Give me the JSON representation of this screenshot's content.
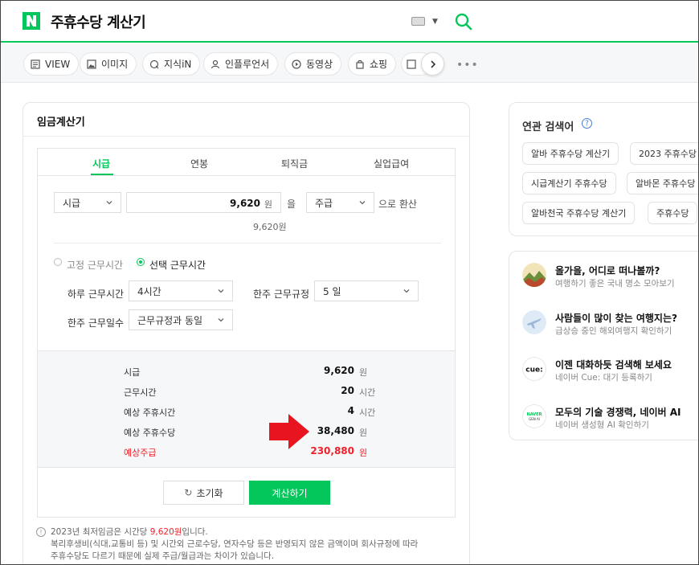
{
  "header": {
    "logo": "N",
    "query": "주휴수당 계산기",
    "icons": [
      "naver-logo-icon",
      "keyboard-icon",
      "search-icon"
    ]
  },
  "tabs": [
    {
      "label": "VIEW",
      "icon": "view-icon"
    },
    {
      "label": "이미지",
      "icon": "image-icon"
    },
    {
      "label": "지식iN",
      "icon": "q-icon"
    },
    {
      "label": "인플루언서",
      "icon": "person-icon"
    },
    {
      "label": "동영상",
      "icon": "play-icon"
    },
    {
      "label": "쇼핑",
      "icon": "bag-icon"
    }
  ],
  "calculator": {
    "title": "임금계산기",
    "tabs": [
      "시급",
      "연봉",
      "퇴직금",
      "실업급여"
    ],
    "active_tab": "시급",
    "wage_type": "시급",
    "amount": "9,620",
    "amount_unit": "원",
    "particle": "을",
    "convert_to": "주급",
    "convert_suffix": "으로 환산",
    "amount_readout": "9,620원",
    "mode_fixed": "고정 근무시간",
    "mode_select": "선택 근무시간",
    "daily_hours_label": "하루 근무시간",
    "daily_hours": "4시간",
    "weekly_rule_label": "한주 근무규정",
    "weekly_rule": "5 일",
    "weekly_days_label": "한주 근무일수",
    "weekly_days": "근무규정과 동일",
    "results": [
      {
        "label": "시급",
        "value": "9,620",
        "unit": "원",
        "highlight": false
      },
      {
        "label": "근무시간",
        "value": "20",
        "unit": "시간",
        "highlight": false
      },
      {
        "label": "예상 주휴시간",
        "value": "4",
        "unit": "시간",
        "highlight": false
      },
      {
        "label": "예상 주휴수당",
        "value": "38,480",
        "unit": "원",
        "highlight": false
      },
      {
        "label": "예상주급",
        "value": "230,880",
        "unit": "원",
        "highlight": true
      }
    ],
    "reset_label": "초기화",
    "calc_label": "계산하기",
    "notice_prefix": "2023년 최저임금은 시간당 ",
    "notice_wage": "9,620원",
    "notice_suffix": "입니다.",
    "notice_line2": "복리후생비(식대,교통비 등) 및 시간외 근로수당, 연자수당 등은 반영되지 않은 금액이며 회사규정에 따라",
    "notice_line3": "주휴수당도 다르기 때문에 실제 주급/월급과는 차이가 있습니다."
  },
  "related": {
    "title": "연관 검색어",
    "keywords": [
      "알바 주휴수당 계산기",
      "2023 주휴수당",
      "시급계산기 주휴수당",
      "알바몬 주휴수당",
      "알바천국 주휴수당 계산기",
      "주휴수당"
    ]
  },
  "promos": [
    {
      "title": "올가을, 어디로 떠나볼까?",
      "sub": "여행하기 좋은 국내 명소 모아보기",
      "icon": "landscape-icon"
    },
    {
      "title": "사람들이 많이 찾는 여행지는?",
      "sub": "급상승 중인 해외여행지 확인하기",
      "icon": "airplane-icon"
    },
    {
      "title": "이젠 대화하듯 검색해 보세요",
      "sub": "네이버 Cue: 대기 등록하기",
      "icon": "cue-logo-icon",
      "logo_text": "cue:"
    },
    {
      "title": "모두의 기술 경쟁력, 네이버 AI",
      "sub": "네이버 생성형 AI 확인하기",
      "icon": "naver-genai-logo-icon",
      "logo_text": "NAVER GEN AI"
    }
  ],
  "colors": {
    "brand_green": "#03c75a",
    "highlight_red": "#f1202a"
  }
}
